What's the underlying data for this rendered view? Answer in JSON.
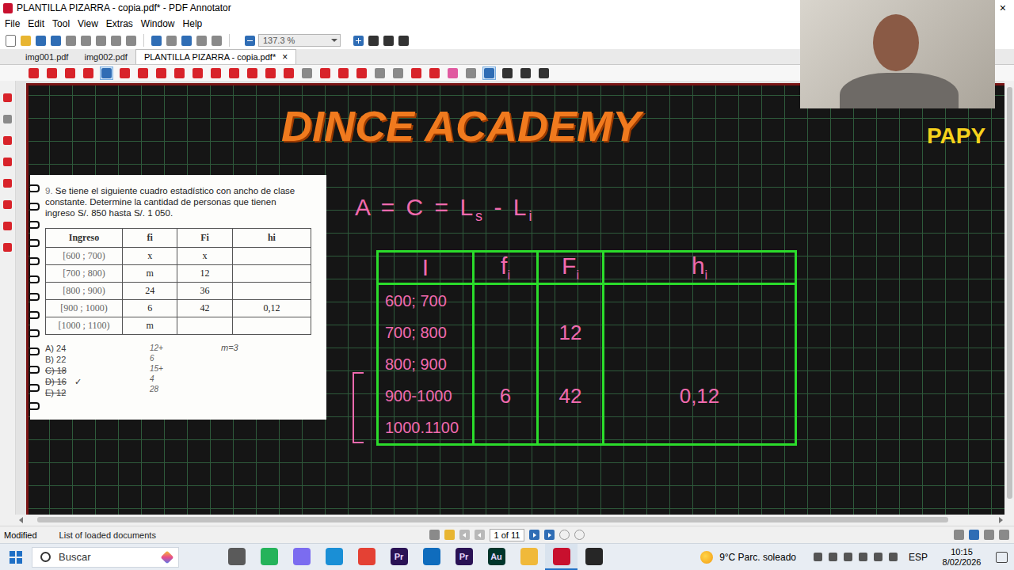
{
  "window": {
    "title": "PLANTILLA PIZARRA - copia.pdf* - PDF Annotator",
    "close": "×"
  },
  "menu": [
    "File",
    "Edit",
    "Tool",
    "View",
    "Extras",
    "Window",
    "Help"
  ],
  "toolbar": {
    "zoom": "137.3 %"
  },
  "tabs": [
    {
      "label": "img001.pdf",
      "selected": false
    },
    {
      "label": "img002.pdf",
      "selected": false
    },
    {
      "label": "PLANTILLA PIZARRA - copia.pdf*",
      "selected": true
    }
  ],
  "tab_close": "×",
  "annotation_toolbar": [
    {
      "selected": false
    },
    {
      "selected": false
    },
    {
      "selected": false
    },
    {
      "selected": false
    },
    {
      "selected": true
    },
    {
      "selected": false
    },
    {
      "selected": false
    },
    {
      "selected": false
    },
    {
      "selected": false
    },
    {
      "selected": false
    },
    {
      "selected": false
    },
    {
      "selected": false
    },
    {
      "selected": false
    },
    {
      "selected": false
    },
    {
      "selected": false
    },
    {
      "selected": false
    },
    {
      "selected": false
    },
    {
      "selected": false
    },
    {
      "selected": false
    },
    {
      "selected": false
    },
    {
      "selected": false
    },
    {
      "selected": false
    },
    {
      "selected": false
    },
    {
      "selected": false
    },
    {
      "selected": false
    },
    {
      "selected": true
    },
    {
      "selected": false
    },
    {
      "selected": false
    },
    {
      "selected": false
    }
  ],
  "board": {
    "brand": "DINCE ACADEMY",
    "side_label": "PAPY",
    "formula": [
      {
        "kind": "text",
        "text": "A = C = L"
      },
      {
        "kind": "sub",
        "text": "s"
      },
      {
        "kind": "text",
        "text": " - L"
      },
      {
        "kind": "sub",
        "text": "i"
      }
    ],
    "hand_table": {
      "headers": [
        {
          "text": "I",
          "sub": ""
        },
        {
          "text": "f",
          "sub": "i"
        },
        {
          "text": "F",
          "sub": "i"
        },
        {
          "text": "h",
          "sub": "i"
        }
      ],
      "rows": [
        [
          "600; 700",
          "",
          "",
          ""
        ],
        [
          "700; 800",
          "",
          "12",
          ""
        ],
        [
          "800; 900",
          "",
          "",
          ""
        ],
        [
          "900-1000",
          "6",
          "42",
          "0,12"
        ],
        [
          "1000.1100",
          "",
          "",
          ""
        ]
      ]
    },
    "worksheet": {
      "number": "9.",
      "question": "Se tiene el siguiente cuadro estadístico con ancho de clase constante. Determine la cantidad de personas que tienen ingreso S/. 850 hasta S/. 1 050.",
      "columns": [
        "Ingreso",
        "fi",
        "Fi",
        "hi"
      ],
      "rows": [
        [
          "[600 ; 700)",
          "x",
          "x",
          ""
        ],
        [
          "[700 ; 800)",
          "m",
          "12",
          ""
        ],
        [
          "[800 ; 900)",
          "24",
          "36",
          ""
        ],
        [
          "[900 ; 1000)",
          "6",
          "42",
          "0,12"
        ],
        [
          "[1000 ; 1100)",
          "m",
          "",
          ""
        ]
      ],
      "options": [
        {
          "label": "A) 24",
          "struck": false,
          "mark": ""
        },
        {
          "label": "B) 22",
          "struck": false,
          "mark": ""
        },
        {
          "label": "C) 18",
          "struck": true,
          "mark": ""
        },
        {
          "label": "D) 16",
          "struck": true,
          "mark": "✓"
        },
        {
          "label": "E) 12",
          "struck": true,
          "mark": ""
        }
      ],
      "sum_notes": [
        "12+",
        "6",
        "15+",
        "4",
        "28"
      ],
      "note": "m=3"
    }
  },
  "status_bar": {
    "state": "Modified",
    "panel": "List of loaded documents",
    "page": "1 of 11"
  },
  "taskbar": {
    "search": "Buscar",
    "apps": [
      {
        "label": "",
        "color": "#5a5a5a",
        "active": false
      },
      {
        "label": "",
        "color": "#25b35a",
        "active": false
      },
      {
        "label": "",
        "color": "#7b6cf0",
        "active": false
      },
      {
        "label": "",
        "color": "#1a8fd6",
        "active": false
      },
      {
        "label": "",
        "color": "#e44134",
        "active": false
      },
      {
        "label": "Pr",
        "color": "#2a1255",
        "active": false
      },
      {
        "label": "",
        "color": "#0f6cbd",
        "active": false
      },
      {
        "label": "Pr",
        "color": "#2a1255",
        "active": false
      },
      {
        "label": "Au",
        "color": "#00352b",
        "active": false
      },
      {
        "label": "",
        "color": "#f0b93a",
        "active": false
      },
      {
        "label": "",
        "color": "#c8102e",
        "active": true
      },
      {
        "label": "",
        "color": "#262626",
        "active": false
      }
    ],
    "weather": "9°C Parc. soleado",
    "language": "ESP",
    "time": "10:15",
    "date": "8/02/2026"
  }
}
